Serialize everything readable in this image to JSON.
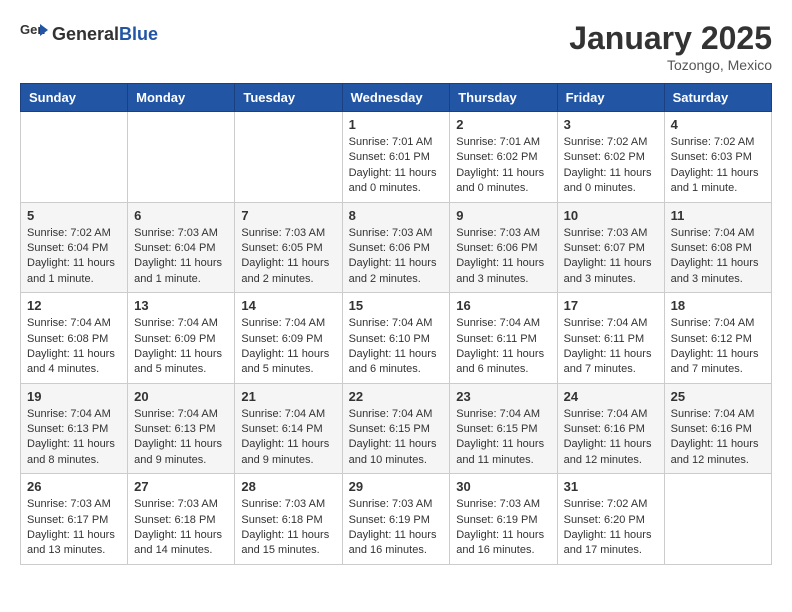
{
  "header": {
    "logo_general": "General",
    "logo_blue": "Blue",
    "month_year": "January 2025",
    "location": "Tozongo, Mexico"
  },
  "days_of_week": [
    "Sunday",
    "Monday",
    "Tuesday",
    "Wednesday",
    "Thursday",
    "Friday",
    "Saturday"
  ],
  "weeks": [
    [
      {
        "day": "",
        "info": ""
      },
      {
        "day": "",
        "info": ""
      },
      {
        "day": "",
        "info": ""
      },
      {
        "day": "1",
        "info": "Sunrise: 7:01 AM\nSunset: 6:01 PM\nDaylight: 11 hours\nand 0 minutes."
      },
      {
        "day": "2",
        "info": "Sunrise: 7:01 AM\nSunset: 6:02 PM\nDaylight: 11 hours\nand 0 minutes."
      },
      {
        "day": "3",
        "info": "Sunrise: 7:02 AM\nSunset: 6:02 PM\nDaylight: 11 hours\nand 0 minutes."
      },
      {
        "day": "4",
        "info": "Sunrise: 7:02 AM\nSunset: 6:03 PM\nDaylight: 11 hours\nand 1 minute."
      }
    ],
    [
      {
        "day": "5",
        "info": "Sunrise: 7:02 AM\nSunset: 6:04 PM\nDaylight: 11 hours\nand 1 minute."
      },
      {
        "day": "6",
        "info": "Sunrise: 7:03 AM\nSunset: 6:04 PM\nDaylight: 11 hours\nand 1 minute."
      },
      {
        "day": "7",
        "info": "Sunrise: 7:03 AM\nSunset: 6:05 PM\nDaylight: 11 hours\nand 2 minutes."
      },
      {
        "day": "8",
        "info": "Sunrise: 7:03 AM\nSunset: 6:06 PM\nDaylight: 11 hours\nand 2 minutes."
      },
      {
        "day": "9",
        "info": "Sunrise: 7:03 AM\nSunset: 6:06 PM\nDaylight: 11 hours\nand 3 minutes."
      },
      {
        "day": "10",
        "info": "Sunrise: 7:03 AM\nSunset: 6:07 PM\nDaylight: 11 hours\nand 3 minutes."
      },
      {
        "day": "11",
        "info": "Sunrise: 7:04 AM\nSunset: 6:08 PM\nDaylight: 11 hours\nand 3 minutes."
      }
    ],
    [
      {
        "day": "12",
        "info": "Sunrise: 7:04 AM\nSunset: 6:08 PM\nDaylight: 11 hours\nand 4 minutes."
      },
      {
        "day": "13",
        "info": "Sunrise: 7:04 AM\nSunset: 6:09 PM\nDaylight: 11 hours\nand 5 minutes."
      },
      {
        "day": "14",
        "info": "Sunrise: 7:04 AM\nSunset: 6:09 PM\nDaylight: 11 hours\nand 5 minutes."
      },
      {
        "day": "15",
        "info": "Sunrise: 7:04 AM\nSunset: 6:10 PM\nDaylight: 11 hours\nand 6 minutes."
      },
      {
        "day": "16",
        "info": "Sunrise: 7:04 AM\nSunset: 6:11 PM\nDaylight: 11 hours\nand 6 minutes."
      },
      {
        "day": "17",
        "info": "Sunrise: 7:04 AM\nSunset: 6:11 PM\nDaylight: 11 hours\nand 7 minutes."
      },
      {
        "day": "18",
        "info": "Sunrise: 7:04 AM\nSunset: 6:12 PM\nDaylight: 11 hours\nand 7 minutes."
      }
    ],
    [
      {
        "day": "19",
        "info": "Sunrise: 7:04 AM\nSunset: 6:13 PM\nDaylight: 11 hours\nand 8 minutes."
      },
      {
        "day": "20",
        "info": "Sunrise: 7:04 AM\nSunset: 6:13 PM\nDaylight: 11 hours\nand 9 minutes."
      },
      {
        "day": "21",
        "info": "Sunrise: 7:04 AM\nSunset: 6:14 PM\nDaylight: 11 hours\nand 9 minutes."
      },
      {
        "day": "22",
        "info": "Sunrise: 7:04 AM\nSunset: 6:15 PM\nDaylight: 11 hours\nand 10 minutes."
      },
      {
        "day": "23",
        "info": "Sunrise: 7:04 AM\nSunset: 6:15 PM\nDaylight: 11 hours\nand 11 minutes."
      },
      {
        "day": "24",
        "info": "Sunrise: 7:04 AM\nSunset: 6:16 PM\nDaylight: 11 hours\nand 12 minutes."
      },
      {
        "day": "25",
        "info": "Sunrise: 7:04 AM\nSunset: 6:16 PM\nDaylight: 11 hours\nand 12 minutes."
      }
    ],
    [
      {
        "day": "26",
        "info": "Sunrise: 7:03 AM\nSunset: 6:17 PM\nDaylight: 11 hours\nand 13 minutes."
      },
      {
        "day": "27",
        "info": "Sunrise: 7:03 AM\nSunset: 6:18 PM\nDaylight: 11 hours\nand 14 minutes."
      },
      {
        "day": "28",
        "info": "Sunrise: 7:03 AM\nSunset: 6:18 PM\nDaylight: 11 hours\nand 15 minutes."
      },
      {
        "day": "29",
        "info": "Sunrise: 7:03 AM\nSunset: 6:19 PM\nDaylight: 11 hours\nand 16 minutes."
      },
      {
        "day": "30",
        "info": "Sunrise: 7:03 AM\nSunset: 6:19 PM\nDaylight: 11 hours\nand 16 minutes."
      },
      {
        "day": "31",
        "info": "Sunrise: 7:02 AM\nSunset: 6:20 PM\nDaylight: 11 hours\nand 17 minutes."
      },
      {
        "day": "",
        "info": ""
      }
    ]
  ]
}
